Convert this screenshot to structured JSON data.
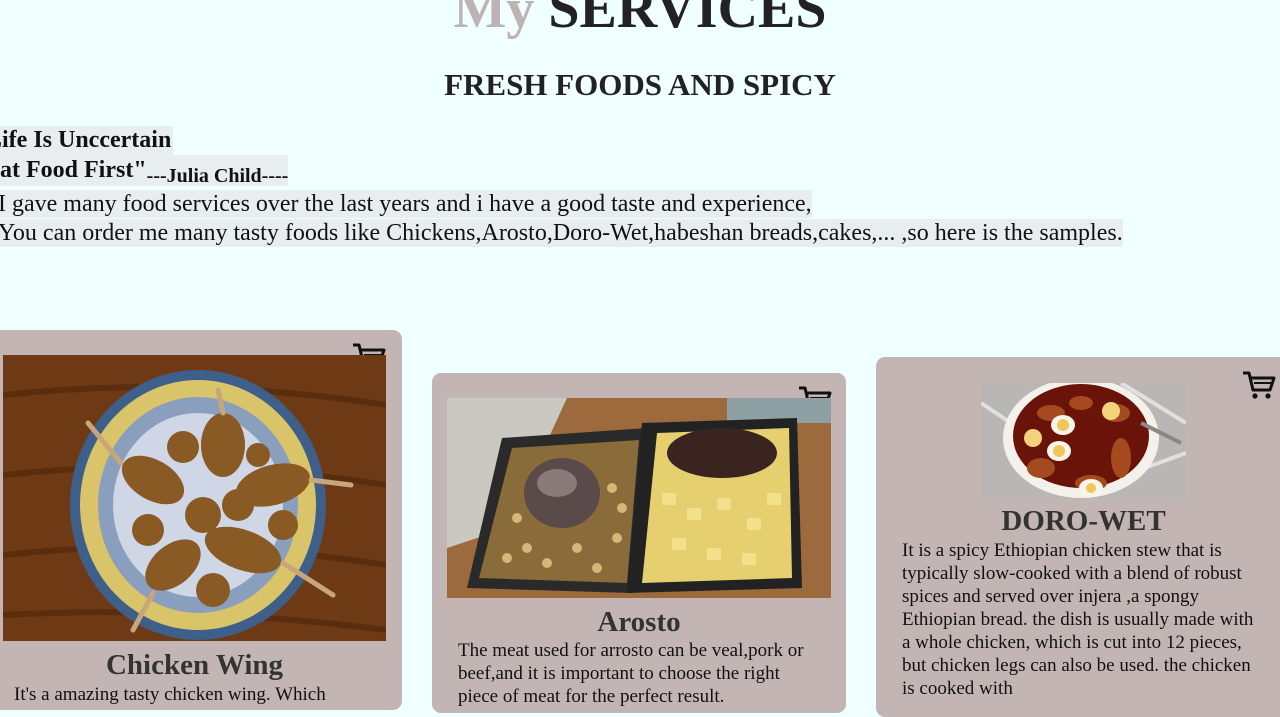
{
  "header": {
    "title_my": "My",
    "title_services": "SERVICES",
    "subtitle": "FRESH FOODS AND SPICY"
  },
  "quote": {
    "line1": "Life Is Unccertain",
    "line2": "Eat Food First\"",
    "author": "---Julia Child----"
  },
  "intro": {
    "line1": "I gave many food services over the last years and i have a good taste and experience,",
    "line2": "You can order me many tasty foods like Chickens,Arosto,Doro-Wet,habeshan breads,cakes,... ,so here is the samples."
  },
  "cards": [
    {
      "title": "Chicken Wing",
      "description": "It's a amazing tasty chicken wing. Which",
      "cart_icon": "shopping-cart-icon"
    },
    {
      "title": "Arosto",
      "description": "The meat used for arrosto can be veal,pork or beef,and it is important to choose the right piece of meat for the perfect result.",
      "cart_icon": "shopping-cart-icon"
    },
    {
      "title": "DORO-WET",
      "description": "It is a spicy Ethiopian chicken stew that is typically slow-cooked with a blend of robust spices and served over injera ,a spongy Ethiopian bread. the dish is usually made with a whole chicken, which is cut into 12 pieces, but chicken legs can also be used. the chicken is cooked with",
      "cart_icon": "shopping-cart-icon"
    }
  ],
  "colors": {
    "background": "#f0ffff",
    "card": "#c4b5b5",
    "title_accent": "#bfb2b2"
  }
}
